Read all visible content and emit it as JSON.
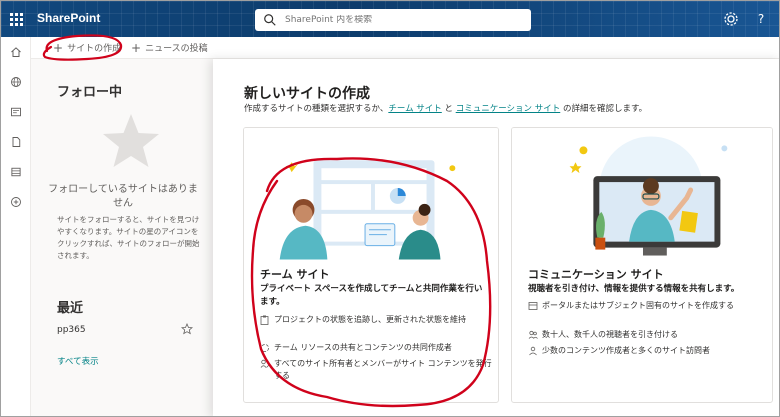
{
  "suite": {
    "brand": "SharePoint",
    "search_placeholder": "SharePoint 内を検索",
    "settings_icon": "gear-icon",
    "help_label": "?"
  },
  "command_bar": {
    "create_site": "サイトの作成",
    "create_news": "ニュースの投稿"
  },
  "left_pane": {
    "following_heading": "フォロー中",
    "empty_title": "フォローしているサイトはありません",
    "empty_desc": "サイトをフォローすると、サイトを見つけやすくなります。サイトの星のアイコンをクリックすれば、サイトのフォローが開始されます。",
    "recent_heading": "最近",
    "recent_items": [
      {
        "label": "pp365"
      }
    ],
    "view_all": "すべて表示"
  },
  "panel": {
    "title": "新しいサイトの作成",
    "subtitle_pre": "作成するサイトの種類を選択するか、",
    "link_team": "チーム サイト",
    "subtitle_mid": " と ",
    "link_comm": "コミュニケーション サイト",
    "subtitle_post": " の詳細を確認します。",
    "cards": [
      {
        "title": "チーム サイト",
        "lead": "プライベート スペースを作成してチームと共同作業を行います。",
        "features": [
          "プロジェクトの状態を追跡し、更新された状態を維持",
          "チーム リソースの共有とコンテンツの共同作成者",
          "すべてのサイト所有者とメンバーがサイト コンテンツを発行する"
        ]
      },
      {
        "title": "コミュニケーション サイト",
        "lead": "視聴者を引き付け、情報を提供する情報を共有します。",
        "features": [
          "ポータルまたはサブジェクト固有のサイトを作成する",
          "数十人、数千人の視聴者を引き付ける",
          "少数のコンテンツ作成者と多くのサイト訪問者"
        ]
      }
    ]
  },
  "colors": {
    "suite_bar": "#0f3f6e",
    "teal_link": "#038387",
    "annotation": "#d0021b"
  }
}
